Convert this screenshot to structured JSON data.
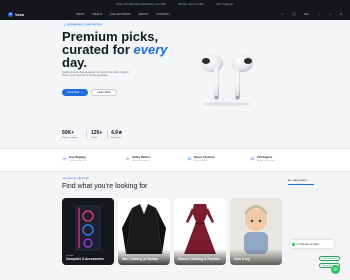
{
  "topbar": {
    "promo": "Free UK Standard Shipping over £50",
    "returns": "30-day return policy",
    "support": "24/7 Support"
  },
  "header": {
    "brand": "Vexo",
    "nav": [
      "SHOP",
      "DEALS",
      "COLLECTIONS",
      "ABOUT",
      "CONTACT"
    ],
    "lang": "EN",
    "cart": "0"
  },
  "hero": {
    "badge": "NEW ARRIVALS · FREE SHIPPING",
    "title_line1": "Premium picks,",
    "title_line2": "curated for ",
    "title_accent": "every",
    "title_line3": "day.",
    "subtitle": "Quality products hand-selected from around the world, shipped direct to your door with a 30-day guarantee.",
    "primary_cta": "Shop Now",
    "secondary_cta": "Learn More",
    "stats": [
      {
        "value": "50K+",
        "label": "Happy Customers"
      },
      {
        "value": "120+",
        "label": "Brands"
      },
      {
        "value": "4.9★",
        "label": "Avg Rating"
      }
    ]
  },
  "features": [
    {
      "icon": "truck-icon",
      "title": "Free Shipping",
      "desc": "On orders over £50"
    },
    {
      "icon": "return-icon",
      "title": "30-Day Returns",
      "desc": "Hassle-free returns"
    },
    {
      "icon": "lock-icon",
      "title": "Secure Checkout",
      "desc": "SSL encrypted"
    },
    {
      "icon": "headset-icon",
      "title": "24/7 Support",
      "desc": "Always here to help"
    }
  ],
  "categories": {
    "badge": "• BROWSE BY CATEGORY",
    "title": "Find what you're looking for",
    "view_all": "ALL CATEGORIES →",
    "items": [
      {
        "label": "Computer & Accessories",
        "count": "24 items"
      },
      {
        "label": "Men Clothing & Fashion",
        "count": "36 items"
      },
      {
        "label": "Women Clothing & Fashion",
        "count": "42 items"
      },
      {
        "label": "Kids & toy",
        "count": "18 items"
      }
    ]
  },
  "chat": {
    "greeting": "👋 How can we help?",
    "quick_1": "I have a question",
    "quick_2": "Tell me about yo"
  },
  "colors": {
    "accent": "#1d6fe0",
    "dark": "#14161c",
    "chat": "#22c55e"
  }
}
